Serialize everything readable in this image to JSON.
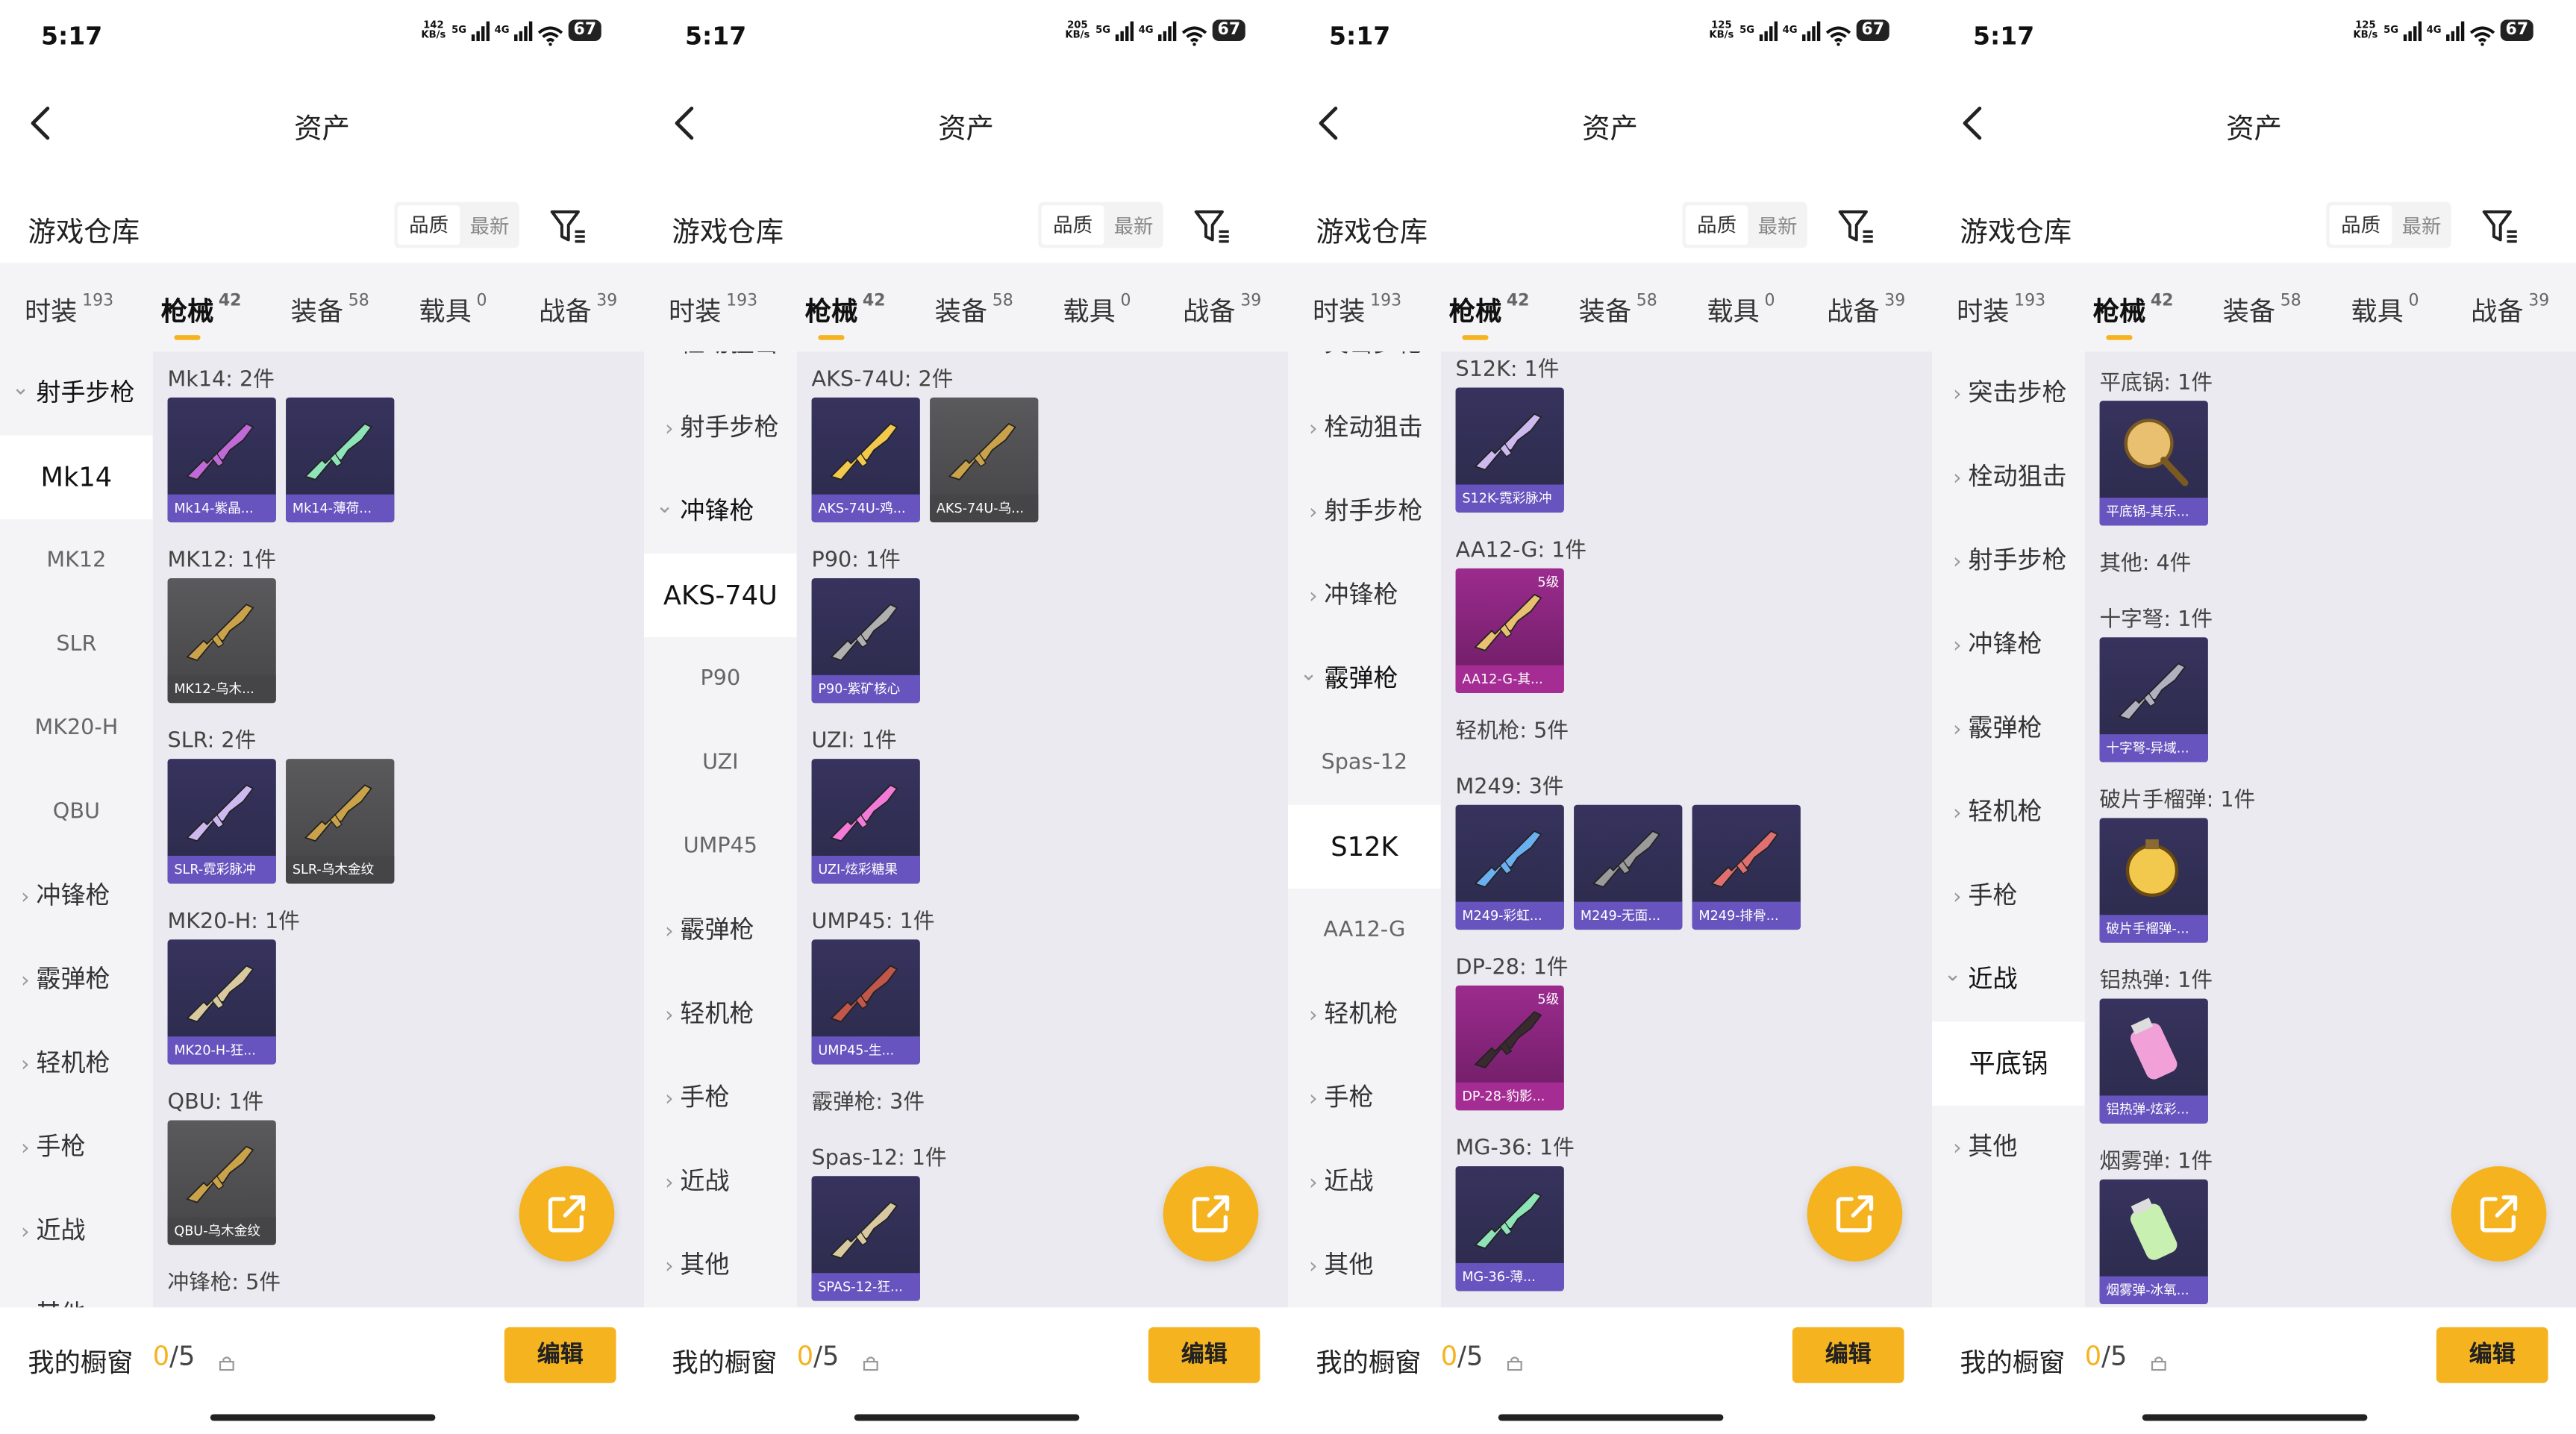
{
  "colors": {
    "accent": "#f5b320",
    "card_blue": "#37335e",
    "card_grey": "#5a5a5c",
    "card_pink": "#9c2b8e"
  },
  "common": {
    "nav_title": "资产",
    "warehouse_title": "游戏仓库",
    "sort_quality": "品质",
    "sort_newest": "最新",
    "tabs": [
      {
        "label": "时装",
        "count": "193"
      },
      {
        "label": "枪械",
        "count": "42"
      },
      {
        "label": "装备",
        "count": "58"
      },
      {
        "label": "载具",
        "count": "0"
      },
      {
        "label": "战备",
        "count": "39"
      }
    ],
    "active_tab_index": 1,
    "showcase_label": "我的橱窗",
    "showcase_zero": "0",
    "showcase_total": "/5",
    "edit_button": "编辑",
    "time": "5:17",
    "network": "5G",
    "network2": "4G",
    "battery": "67",
    "icons": [
      "back-icon",
      "filter-icon",
      "share-icon",
      "lock-icon",
      "signal-icon",
      "wifi-icon",
      "battery-icon"
    ]
  },
  "panels": [
    {
      "speed": "142",
      "speed_unit": "KB/s",
      "sidebar": [
        {
          "label": "射手步枪",
          "kind": "open"
        },
        {
          "label": "Mk14",
          "kind": "selected"
        },
        {
          "label": "MK12",
          "kind": "sub"
        },
        {
          "label": "SLR",
          "kind": "sub"
        },
        {
          "label": "MK20-H",
          "kind": "sub"
        },
        {
          "label": "QBU",
          "kind": "sub"
        },
        {
          "label": "冲锋枪",
          "kind": "closed"
        },
        {
          "label": "霰弹枪",
          "kind": "closed"
        },
        {
          "label": "轻机枪",
          "kind": "closed"
        },
        {
          "label": "手枪",
          "kind": "closed"
        },
        {
          "label": "近战",
          "kind": "closed"
        },
        {
          "label": "其他",
          "kind": "closed"
        }
      ],
      "groups": [
        {
          "label": "Mk14: 2件",
          "items": [
            {
              "caption": "Mk14-紫晶...",
              "style": "blue",
              "gun": "#c06ad8"
            },
            {
              "caption": "Mk14-薄荷...",
              "style": "blue",
              "gun": "#8fe3b8"
            }
          ]
        },
        {
          "label": "MK12: 1件",
          "items": [
            {
              "caption": "MK12-乌木...",
              "style": "grey",
              "gun": "#c9a24a"
            }
          ]
        },
        {
          "label": "SLR: 2件",
          "items": [
            {
              "caption": "SLR-霓彩脉冲",
              "style": "blue",
              "gun": "#cdb8f0"
            },
            {
              "caption": "SLR-乌木金纹",
              "style": "grey",
              "gun": "#c9a24a"
            }
          ]
        },
        {
          "label": "MK20-H: 1件",
          "items": [
            {
              "caption": "MK20-H-狂...",
              "style": "blue",
              "gun": "#d8c9a0"
            }
          ]
        },
        {
          "label": "QBU: 1件",
          "items": [
            {
              "caption": "QBU-乌木金纹",
              "style": "grey",
              "gun": "#c9a24a"
            }
          ]
        },
        {
          "label": "冲锋枪: 5件",
          "items": []
        }
      ]
    },
    {
      "speed": "205",
      "speed_unit": "KB/s",
      "sidebar": [
        {
          "label": "栓动狙击",
          "kind": "closed"
        },
        {
          "label": "射手步枪",
          "kind": "closed"
        },
        {
          "label": "冲锋枪",
          "kind": "open"
        },
        {
          "label": "AKS-74U",
          "kind": "selected"
        },
        {
          "label": "P90",
          "kind": "sub"
        },
        {
          "label": "UZI",
          "kind": "sub"
        },
        {
          "label": "UMP45",
          "kind": "sub"
        },
        {
          "label": "霰弹枪",
          "kind": "closed"
        },
        {
          "label": "轻机枪",
          "kind": "closed"
        },
        {
          "label": "手枪",
          "kind": "closed"
        },
        {
          "label": "近战",
          "kind": "closed"
        },
        {
          "label": "其他",
          "kind": "closed"
        }
      ],
      "groups": [
        {
          "label": "AKS-74U: 2件",
          "items": [
            {
              "caption": "AKS-74U-鸡...",
              "style": "blue",
              "gun": "#f2c94c"
            },
            {
              "caption": "AKS-74U-乌...",
              "style": "grey",
              "gun": "#c9a24a"
            }
          ]
        },
        {
          "label": "P90: 1件",
          "items": [
            {
              "caption": "P90-紫矿核心",
              "style": "blue",
              "gun": "#b0b0b0"
            }
          ]
        },
        {
          "label": "UZI: 1件",
          "items": [
            {
              "caption": "UZI-炫彩糖果",
              "style": "blue",
              "gun": "#f27ad8"
            }
          ]
        },
        {
          "label": "UMP45: 1件",
          "items": [
            {
              "caption": "UMP45-生...",
              "style": "blue",
              "gun": "#c0574a"
            }
          ]
        },
        {
          "label": "霰弹枪: 3件",
          "items": []
        },
        {
          "label": "Spas-12: 1件",
          "items": [
            {
              "caption": "SPAS-12-狂...",
              "style": "blue",
              "gun": "#d8c9a0"
            }
          ]
        }
      ]
    },
    {
      "speed": "125",
      "speed_unit": "KB/s",
      "sidebar": [
        {
          "label": "突击步枪",
          "kind": "closed"
        },
        {
          "label": "栓动狙击",
          "kind": "closed"
        },
        {
          "label": "射手步枪",
          "kind": "closed"
        },
        {
          "label": "冲锋枪",
          "kind": "closed"
        },
        {
          "label": "霰弹枪",
          "kind": "open"
        },
        {
          "label": "Spas-12",
          "kind": "sub"
        },
        {
          "label": "S12K",
          "kind": "selected"
        },
        {
          "label": "AA12-G",
          "kind": "sub"
        },
        {
          "label": "轻机枪",
          "kind": "closed"
        },
        {
          "label": "手枪",
          "kind": "closed"
        },
        {
          "label": "近战",
          "kind": "closed"
        },
        {
          "label": "其他",
          "kind": "closed"
        }
      ],
      "groups": [
        {
          "label": "S12K: 1件",
          "items": [
            {
              "caption": "S12K-霓彩脉冲",
              "style": "blue",
              "gun": "#cdb8f0"
            }
          ]
        },
        {
          "label": "AA12-G: 1件",
          "items": [
            {
              "caption": "AA12-G-其...",
              "style": "pink",
              "gun": "#e8c070",
              "level": "5级"
            }
          ]
        },
        {
          "label": "轻机枪: 5件",
          "items": []
        },
        {
          "label": "M249: 3件",
          "items": [
            {
              "caption": "M249-彩虹...",
              "style": "blue",
              "gun": "#6ab0f0"
            },
            {
              "caption": "M249-无面...",
              "style": "blue",
              "gun": "#9a9a9a"
            },
            {
              "caption": "M249-排骨...",
              "style": "blue",
              "gun": "#e07070"
            }
          ]
        },
        {
          "label": "DP-28: 1件",
          "items": [
            {
              "caption": "DP-28-豹影...",
              "style": "pink",
              "gun": "#3a2a30",
              "level": "5级"
            }
          ]
        },
        {
          "label": "MG-36: 1件",
          "items": [
            {
              "caption": "MG-36-薄...",
              "style": "blue",
              "gun": "#8fe3b8"
            }
          ]
        }
      ]
    },
    {
      "speed": "125",
      "speed_unit": "KB/s",
      "sidebar": [
        {
          "label": "突击步枪",
          "kind": "closed"
        },
        {
          "label": "栓动狙击",
          "kind": "closed"
        },
        {
          "label": "射手步枪",
          "kind": "closed"
        },
        {
          "label": "冲锋枪",
          "kind": "closed"
        },
        {
          "label": "霰弹枪",
          "kind": "closed"
        },
        {
          "label": "轻机枪",
          "kind": "closed"
        },
        {
          "label": "手枪",
          "kind": "closed"
        },
        {
          "label": "近战",
          "kind": "open"
        },
        {
          "label": "平底锅",
          "kind": "selected"
        },
        {
          "label": "其他",
          "kind": "closed"
        }
      ],
      "groups": [
        {
          "label": "平底锅: 1件",
          "items": [
            {
              "caption": "平底锅-其乐...",
              "style": "blue",
              "gun": "#e8c070",
              "shape": "pan"
            }
          ]
        },
        {
          "label": "其他: 4件",
          "items": []
        },
        {
          "label": "十字弩: 1件",
          "items": [
            {
              "caption": "十字弩-异域...",
              "style": "blue",
              "gun": "#b0b0c0"
            }
          ]
        },
        {
          "label": "破片手榴弹: 1件",
          "items": [
            {
              "caption": "破片手榴弹-...",
              "style": "blue",
              "gun": "#f2c94c",
              "shape": "ball"
            }
          ]
        },
        {
          "label": "铝热弹: 1件",
          "items": [
            {
              "caption": "铝热弹-炫彩...",
              "style": "blue",
              "gun": "#f2a0d8",
              "shape": "can"
            }
          ]
        },
        {
          "label": "烟雾弹: 1件",
          "items": [
            {
              "caption": "烟雾弹-冰氧...",
              "style": "blue",
              "gun": "#c8f0b0",
              "shape": "can"
            }
          ]
        }
      ]
    }
  ]
}
